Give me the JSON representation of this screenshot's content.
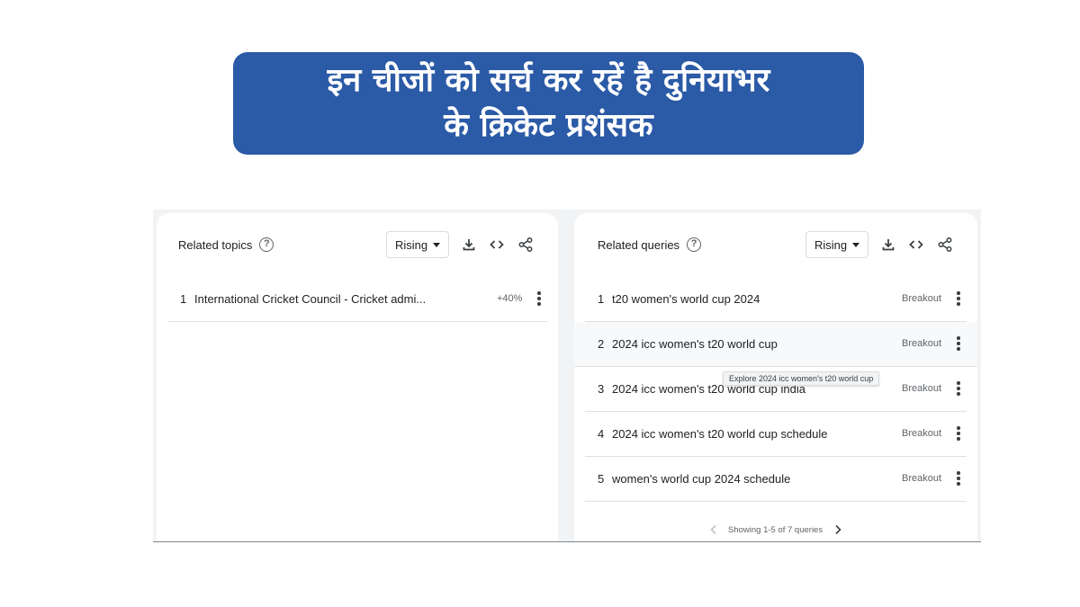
{
  "banner": {
    "line1": "इन चीजों को सर्च कर रहें है दुनियाभर",
    "line2": "के क्रिकेट प्रशंसक"
  },
  "related_topics": {
    "title": "Related topics",
    "filter": "Rising",
    "tools": [
      "download-icon",
      "embed-code-icon",
      "share-icon"
    ],
    "items": [
      {
        "rank": "1",
        "label": "International Cricket Council - Cricket admi...",
        "value": "+40%"
      }
    ]
  },
  "related_queries": {
    "title": "Related queries",
    "filter": "Rising",
    "tools": [
      "download-icon",
      "embed-code-icon",
      "share-icon"
    ],
    "items": [
      {
        "rank": "1",
        "label": "t20 women's world cup 2024",
        "value": "Breakout"
      },
      {
        "rank": "2",
        "label": "2024 icc women's t20 world cup",
        "value": "Breakout"
      },
      {
        "rank": "3",
        "label": "2024 icc women's t20 world cup india",
        "value": "Breakout"
      },
      {
        "rank": "4",
        "label": "2024 icc women's t20 world cup schedule",
        "value": "Breakout"
      },
      {
        "rank": "5",
        "label": "women's world cup 2024 schedule",
        "value": "Breakout"
      }
    ],
    "tooltip": "Explore 2024 icc women's t20 world cup",
    "pager": "Showing 1-5 of 7 queries"
  },
  "colors": {
    "banner_bg": "#2b5aa6",
    "banner_text": "#ffffff",
    "panel_bg": "#f1f3f4",
    "card_bg": "#ffffff"
  }
}
